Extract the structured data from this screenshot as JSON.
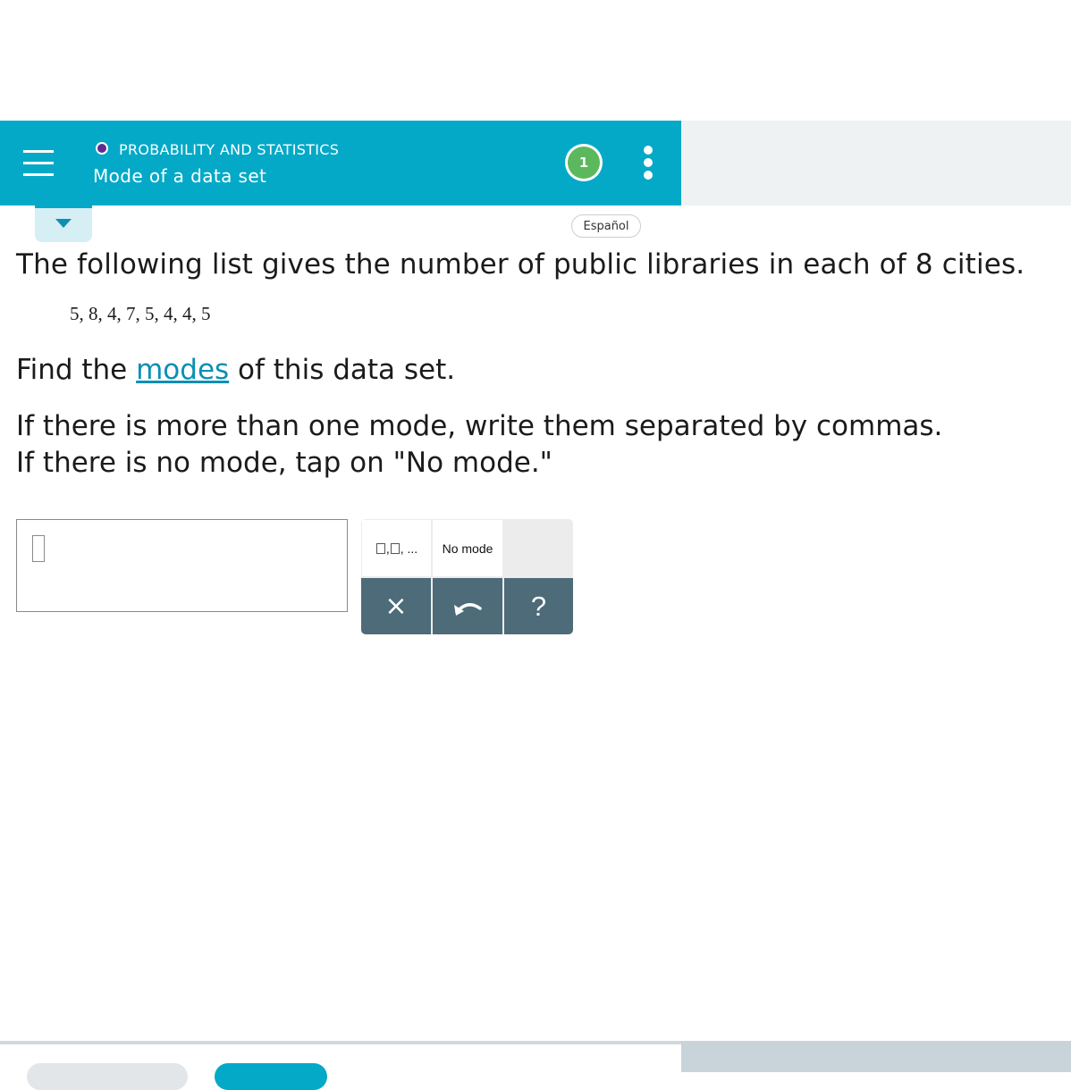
{
  "header": {
    "topic": "PROBABILITY AND STATISTICS",
    "lesson_title": "Mode of a data set",
    "progress_count": "1"
  },
  "language_button": "Español",
  "problem": {
    "intro": "The following list gives the number of public libraries in each of 8 cities.",
    "data_list": "5, 8, 4, 7, 5, 4, 4, 5",
    "find_prefix": "Find the ",
    "find_link": "modes",
    "find_suffix": " of this data set.",
    "instruction_1": "If there is more than one mode, write them separated by commas.",
    "instruction_2": "If there is no mode, tap on \"No mode.\""
  },
  "keypad": {
    "list_key_suffix": "...",
    "no_mode_label": "No mode",
    "clear_label": "×",
    "help_label": "?"
  },
  "colors": {
    "header_bg": "#04a9c7",
    "link": "#0b8fb5",
    "keypad_dark": "#4d6b78",
    "badge_green": "#5cb85c"
  },
  "icons": [
    "menu-icon",
    "more-vertical-icon",
    "caret-down-icon",
    "undo-icon"
  ]
}
